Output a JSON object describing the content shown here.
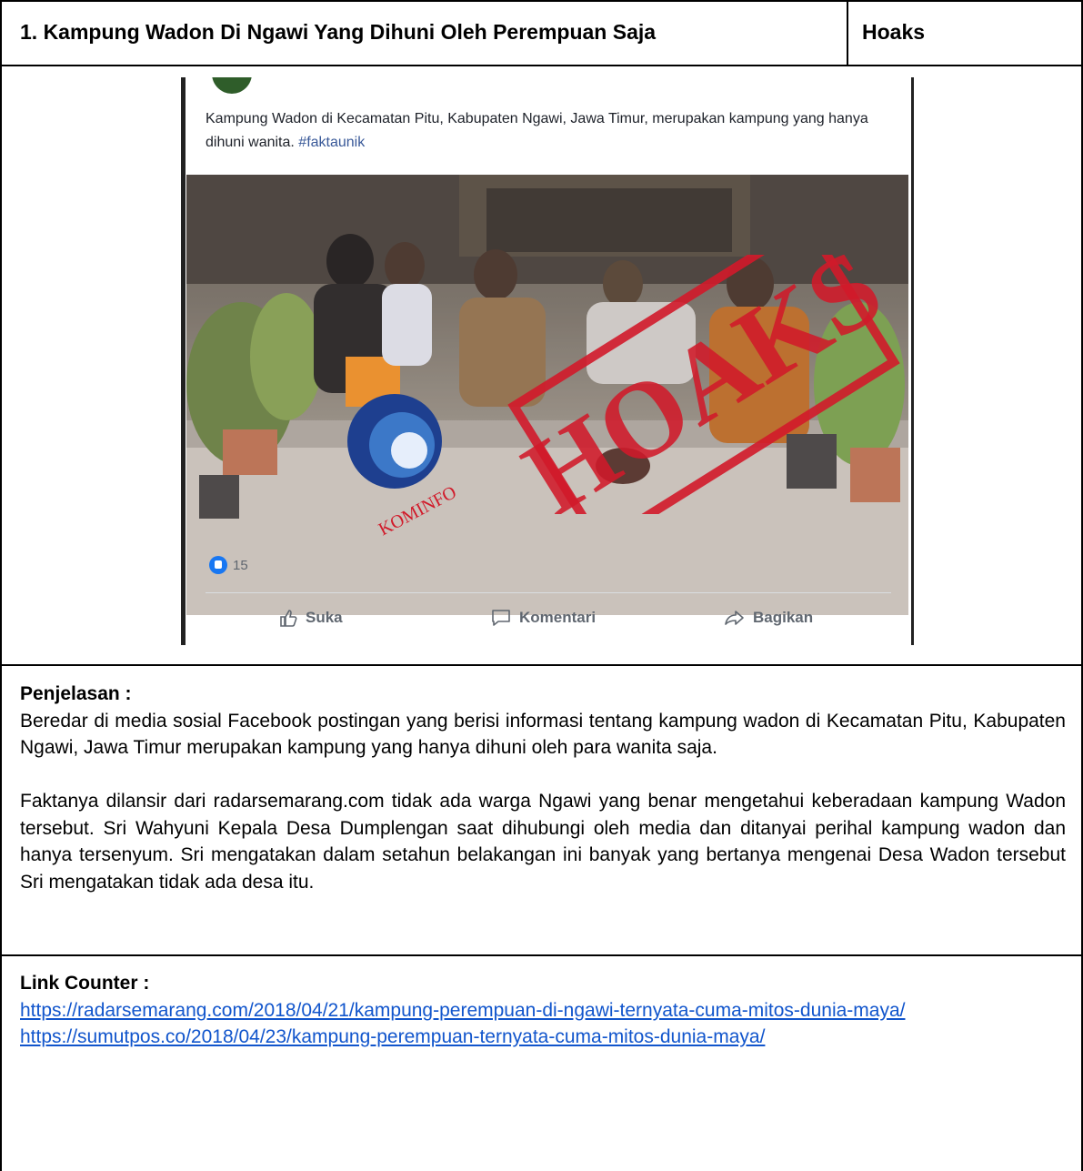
{
  "header": {
    "title": "1. Kampung Wadon Di Ngawi Yang Dihuni Oleh Perempuan Saja",
    "verdict": "Hoaks"
  },
  "post": {
    "text": "Kampung Wadon di Kecamatan Pitu, Kabupaten Ngawi, Jawa Timur, merupakan kampung yang hanya dihuni wanita.",
    "hashtag": "#faktaunik",
    "like_count": "15",
    "actions": {
      "like": "Suka",
      "comment": "Komentari",
      "share": "Bagikan"
    },
    "stamp_text": "HOAKS",
    "logo_text": "KOMINFO",
    "colors": {
      "stamp": "#d11a2a",
      "like": "#1877f2",
      "link": "#1155cc"
    }
  },
  "explanation": {
    "label": "Penjelasan :",
    "paragraph1": "Beredar di media sosial Facebook postingan yang berisi informasi tentang kampung wadon di Kecamatan Pitu, Kabupaten Ngawi, Jawa Timur merupakan kampung yang hanya dihuni oleh para wanita saja.",
    "paragraph2": "Faktanya dilansir dari radarsemarang.com tidak ada warga Ngawi yang benar mengetahui keberadaan kampung Wadon tersebut. Sri Wahyuni Kepala Desa Dumplengan saat dihubungi oleh media dan ditanyai perihal kampung wadon dan hanya tersenyum. Sri mengatakan dalam setahun belakangan ini banyak yang bertanya mengenai Desa Wadon tersebut Sri mengatakan tidak ada desa itu."
  },
  "counter": {
    "label": "Link Counter :",
    "links": [
      "https://radarsemarang.com/2018/04/21/kampung-perempuan-di-ngawi-ternyata-cuma-mitos-dunia-maya/",
      "https://sumutpos.co/2018/04/23/kampung-perempuan-ternyata-cuma-mitos-dunia-maya/"
    ]
  }
}
